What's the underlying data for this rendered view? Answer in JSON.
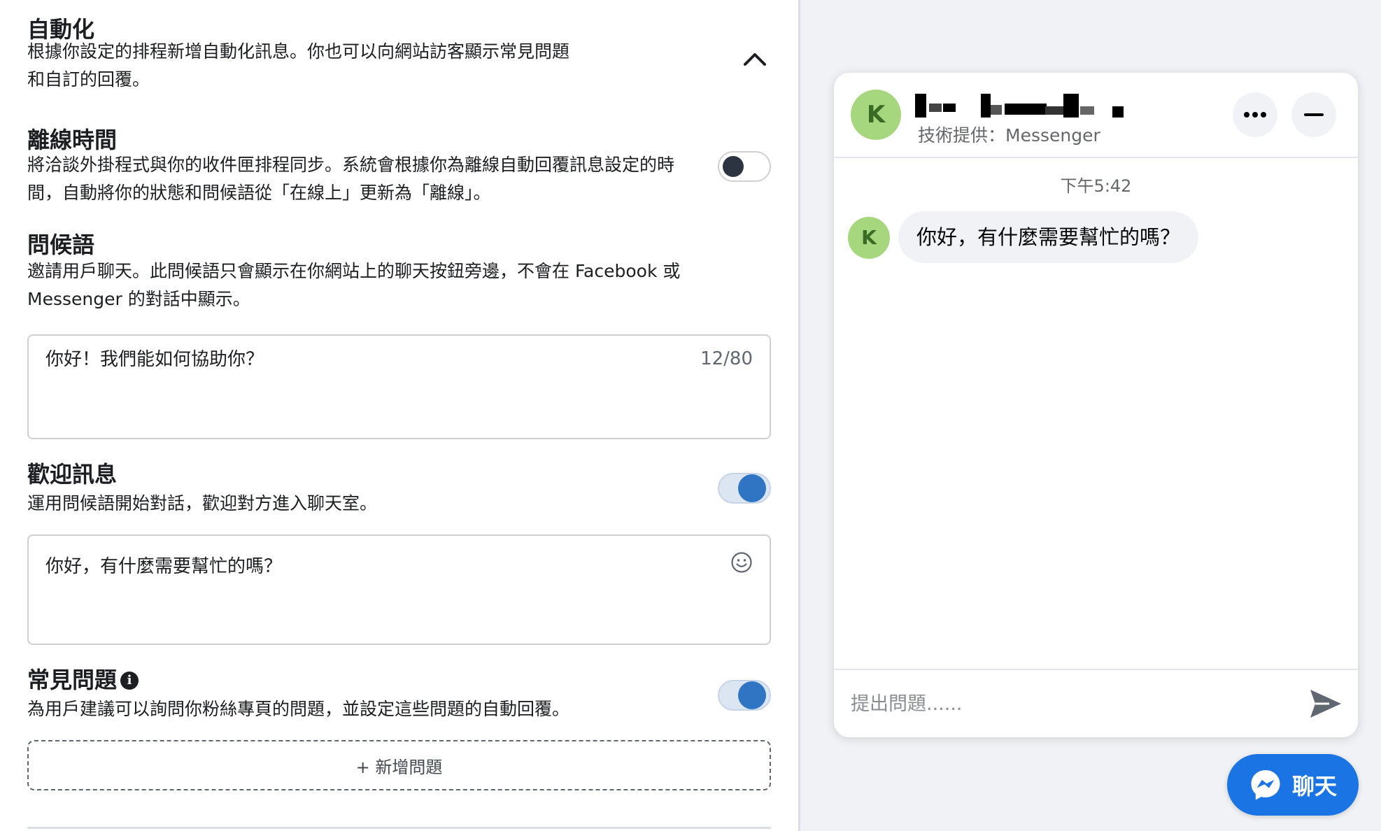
{
  "automation": {
    "title": "自動化",
    "description": "根據你設定的排程新增自動化訊息。你也可以向網站訪客顯示常見問題和自訂的回覆。",
    "collapse_icon": "chevron-up-icon"
  },
  "offline": {
    "title": "離線時間",
    "description": "將洽談外掛程式與你的收件匣排程同步。系統會根據你為離線自動回覆訊息設定的時間，自動將你的狀態和問候語從「在線上」更新為「離線」。",
    "enabled": false
  },
  "greeting": {
    "title": "問候語",
    "description": "邀請用戶聊天。此問候語只會顯示在你網站上的聊天按鈕旁邊，不會在 Facebook 或 Messenger 的對話中顯示。",
    "value": "你好！我們能如何協助你？",
    "char_count": "12/80"
  },
  "welcome": {
    "title": "歡迎訊息",
    "description": "運用問候語開始對話，歡迎對方進入聊天室。",
    "enabled": true,
    "value": "你好，有什麼需要幫忙的嗎？",
    "emoji_icon": "smiley-icon"
  },
  "faq": {
    "title": "常見問題",
    "info_icon": "info-icon",
    "description": "為用戶建議可以詢問你粉絲專頁的問題，並設定這些問題的自動回覆。",
    "enabled": true,
    "add_button": "+ 新增問題"
  },
  "preview": {
    "avatar_letter": "K",
    "powered_by": "技術提供：Messenger",
    "more_icon": "more-dots-icon",
    "minimize_icon": "minimize-icon",
    "timestamp": "下午5:42",
    "message": "你好，有什麼需要幫忙的嗎？",
    "composer_placeholder": "提出問題......",
    "send_icon": "send-icon",
    "chat_button": "聊天",
    "chat_button_icon": "messenger-icon"
  },
  "colors": {
    "accent": "#1b74e4",
    "toggle_on": "#2f75c4",
    "avatar_bg": "#a6d67e",
    "panel_bg": "#f0f2f5"
  }
}
